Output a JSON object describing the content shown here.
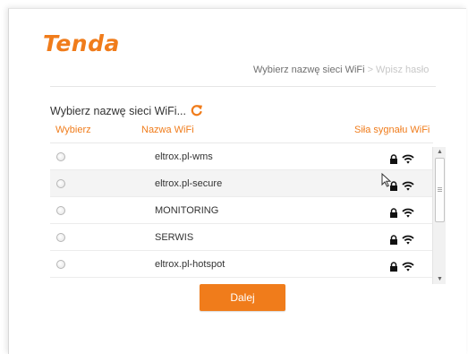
{
  "brand": {
    "logo": "Tenda",
    "accent": "#f07c1b"
  },
  "breadcrumb": {
    "step1": "Wybierz nazwę sieci WiFi",
    "separator": ">",
    "step2": "Wpisz hasło"
  },
  "section": {
    "title": "Wybierz nazwę sieci WiFi...",
    "refresh_icon": "refresh-icon"
  },
  "table": {
    "headers": {
      "select": "Wybierz",
      "name": "Nazwa WiFi",
      "signal": "Siła sygnału WiFi"
    },
    "rows": [
      {
        "ssid": "eltrox.pl-wms",
        "locked": true,
        "selected": false
      },
      {
        "ssid": "eltrox.pl-secure",
        "locked": true,
        "selected": false
      },
      {
        "ssid": "MONITORING",
        "locked": true,
        "selected": false
      },
      {
        "ssid": "SERWIS",
        "locked": true,
        "selected": false
      },
      {
        "ssid": "eltrox.pl-hotspot",
        "locked": true,
        "selected": false
      }
    ]
  },
  "actions": {
    "next_label": "Dalej"
  }
}
